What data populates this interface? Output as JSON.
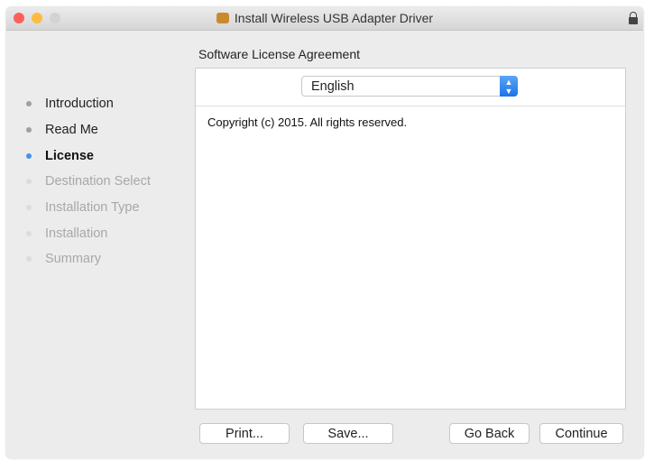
{
  "window": {
    "title": "Install Wireless USB Adapter Driver"
  },
  "heading": "Software License Agreement",
  "sidebar": {
    "items": [
      {
        "label": "Introduction",
        "state": "done"
      },
      {
        "label": "Read Me",
        "state": "done"
      },
      {
        "label": "License",
        "state": "current"
      },
      {
        "label": "Destination Select",
        "state": "pending"
      },
      {
        "label": "Installation Type",
        "state": "pending"
      },
      {
        "label": "Installation",
        "state": "pending"
      },
      {
        "label": "Summary",
        "state": "pending"
      }
    ]
  },
  "language_select": {
    "value": "English"
  },
  "license_text": "Copyright (c) 2015.  All rights reserved.",
  "buttons": {
    "print": "Print...",
    "save": "Save...",
    "go_back": "Go Back",
    "continue": "Continue"
  },
  "colors": {
    "accent": "#4a90e2",
    "close": "#fc605b",
    "minimize": "#fdbc40"
  }
}
